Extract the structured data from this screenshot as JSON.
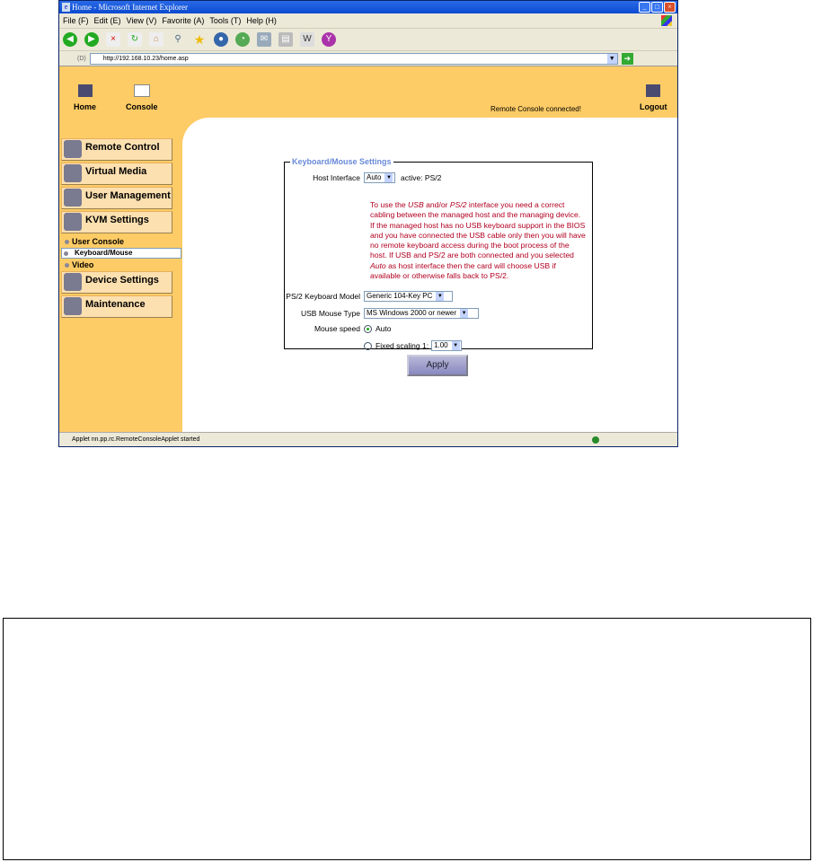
{
  "window": {
    "title": "Home - Microsoft Internet Explorer"
  },
  "menu": [
    "File (F)",
    "Edit (E)",
    "View (V)",
    "Favorite (A)",
    "Tools (T)",
    "Help (H)"
  ],
  "address": {
    "label": "(D)",
    "url": "http://192.168.10.23/home.asp"
  },
  "topnav": {
    "home": "Home",
    "console": "Console",
    "status": "Remote Console connected!",
    "logout": "Logout"
  },
  "sidebar": {
    "items": [
      "Remote Control",
      "Virtual Media",
      "User Management",
      "KVM Settings"
    ],
    "sub": [
      "User Console",
      "Keyboard/Mouse",
      "Video"
    ],
    "items2": [
      "Device Settings",
      "Maintenance"
    ]
  },
  "form": {
    "legend": "Keyboard/Mouse Settings",
    "host_label": "Host Interface",
    "host_value": "Auto",
    "host_active": "active: PS/2",
    "note_parts": [
      "To use the ",
      "USB",
      " and/or ",
      "PS/2",
      " interface you need a correct cabling between the managed host and the managing device. If the managed host has no USB keyboard support in the BIOS and you have connected the USB cable only then you will have no remote keyboard access during the boot process of the host. If USB and PS/2 are both connected and you selected ",
      "Auto",
      " as host interface then the card will choose USB if available or otherwise falls back to PS/2."
    ],
    "kbd_label": "PS/2 Keyboard Model",
    "kbd_value": "Generic 104-Key PC",
    "mouse_label": "USB Mouse Type",
    "mouse_value": "MS Windows 2000 or newer",
    "speed_label": "Mouse speed",
    "speed_auto": "Auto",
    "speed_fixed": "Fixed scaling 1:",
    "speed_scale": "1.00",
    "speed_selected": "Auto",
    "apply": "Apply"
  },
  "statusbar": "Applet nn.pp.rc.RemoteConsoleApplet started"
}
